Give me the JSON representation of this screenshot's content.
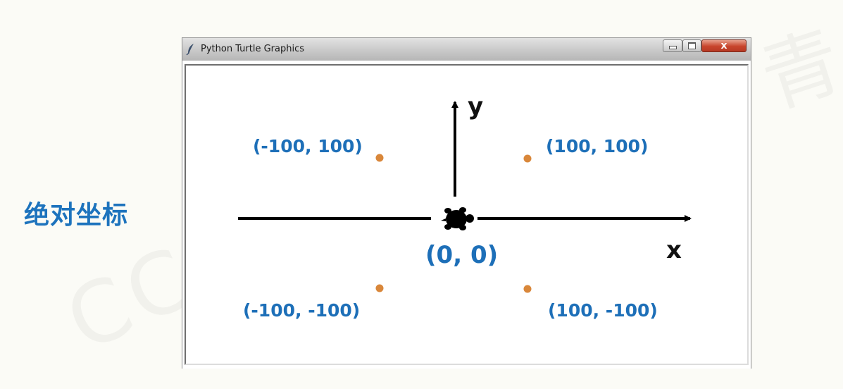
{
  "side_label": "绝对坐标",
  "window": {
    "title": "Python Turtle Graphics",
    "controls": [
      "minimize",
      "maximize",
      "close"
    ],
    "icons": {
      "app": "feather-icon",
      "minimize": "minimize-icon",
      "maximize": "maximize-icon",
      "close": "close-icon"
    },
    "close_glyph": "x"
  },
  "canvas": {
    "axis_labels": {
      "x": "x",
      "y": "y"
    },
    "origin_label": "(0, 0)",
    "points": [
      {
        "label": "(-100, 100)"
      },
      {
        "label": "(100, 100)"
      },
      {
        "label": "(-100, -100)"
      },
      {
        "label": "(100, -100)"
      }
    ],
    "turtle_icon": "turtle-icon"
  },
  "colors": {
    "label_blue": "#1d6fb8",
    "point_orange": "#d9873a",
    "axis_black": "#000000"
  }
}
